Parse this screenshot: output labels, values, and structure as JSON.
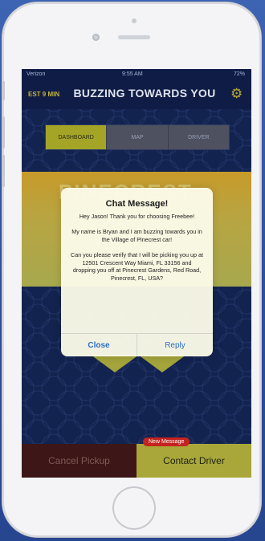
{
  "status_bar": {
    "carrier": "Verizon",
    "time": "9:55 AM",
    "battery": "72%"
  },
  "header": {
    "eta": "EST 9 MIN",
    "title": "BUZZING TOWARDS YOU"
  },
  "tabs": [
    {
      "label": "DASHBOARD"
    },
    {
      "label": "MAP"
    },
    {
      "label": "DRIVER"
    }
  ],
  "banner": {
    "text": "PINECREST"
  },
  "dialog": {
    "title": "Chat Message!",
    "message": "Hey Jason! Thank you for choosing Freebee!\n\nMy name is Bryan and I am buzzing towards you in the Village of Pinecrest car!\n\nCan you please verify that I will be picking you up at 12501 Crescent Way Miami, FL  33156 and dropping you off at Pinecrest Gardens, Red Road, Pinecrest, FL, USA?",
    "close_label": "Close",
    "reply_label": "Reply"
  },
  "bottom": {
    "cancel_label": "Cancel Pickup",
    "contact_label": "Contact Driver",
    "badge": "New Message"
  },
  "icons": {
    "settings": "gear-icon"
  },
  "colors": {
    "accent": "#a9a739",
    "badge": "#c4231f",
    "link": "#2f6fc2"
  }
}
